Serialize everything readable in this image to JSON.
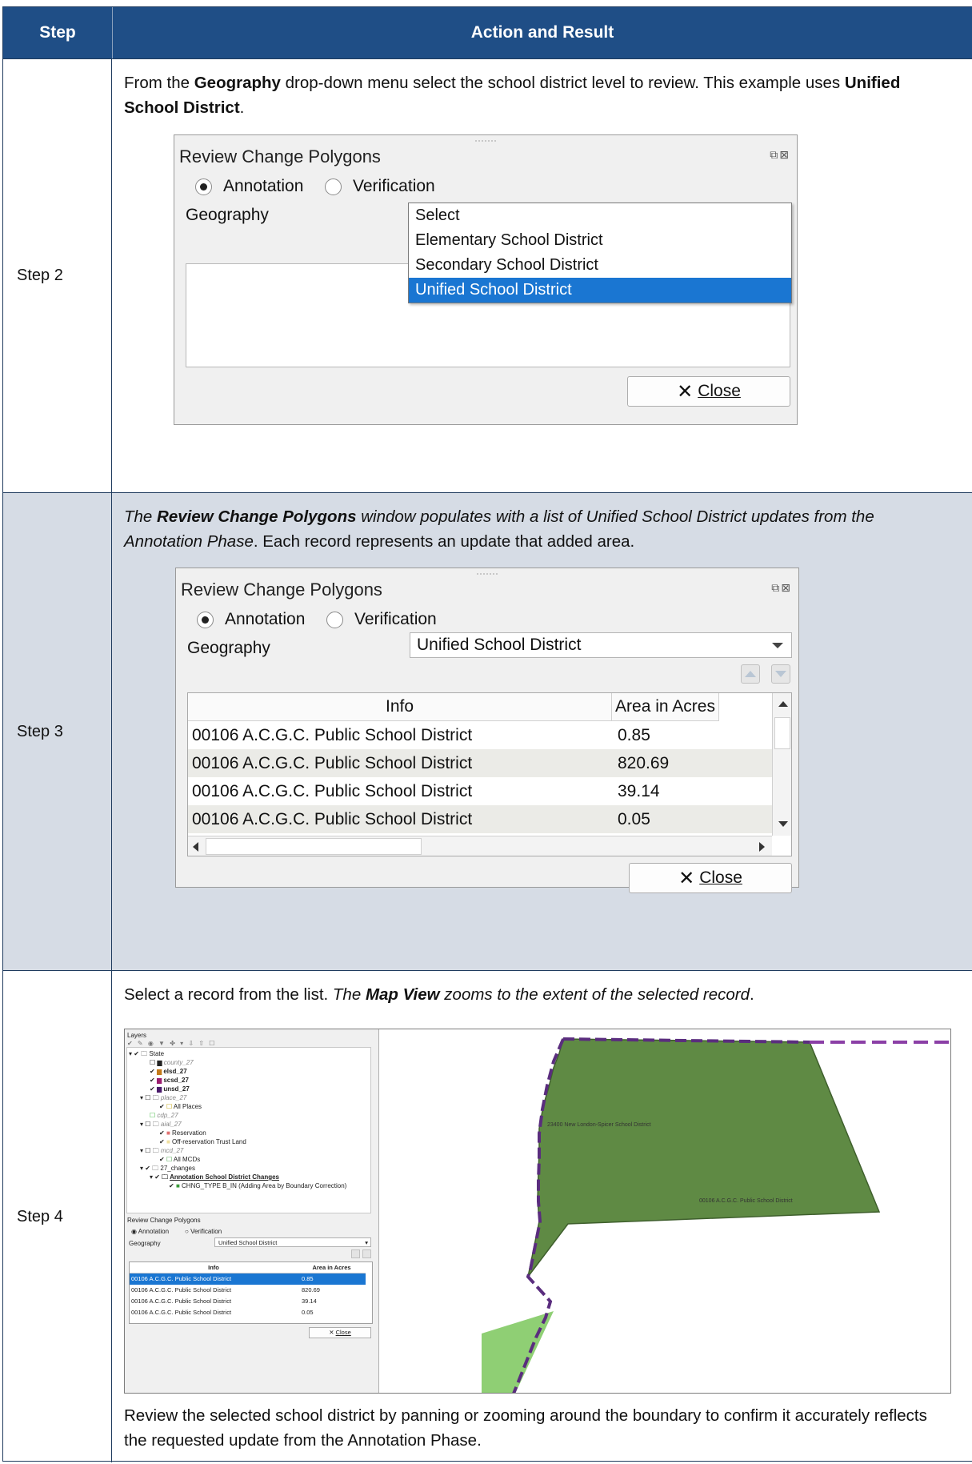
{
  "table": {
    "header": {
      "step": "Step",
      "action": "Action and Result"
    },
    "rows": [
      {
        "step": "Step 2",
        "text_parts": [
          "From the ",
          "Geography",
          " drop-down menu select the school district level to review. This example uses ",
          "Unified School District",
          "."
        ],
        "dialog": {
          "title": "Review Change Polygons",
          "radio_annotation": "Annotation",
          "radio_verification": "Verification",
          "geography_label": "Geography",
          "dropdown_options": [
            "Select",
            "Elementary School District",
            "Secondary School District",
            "Unified School District"
          ],
          "selected_option": "Unified School District",
          "close_label": "Close"
        }
      },
      {
        "step": "Step 3",
        "text_parts": [
          "The ",
          "Review Change Polygons",
          " window populates with a list of Unified School District updates from the Annotation Phase",
          ". Each record represents an update that added area."
        ],
        "dialog": {
          "title": "Review Change Polygons",
          "radio_annotation": "Annotation",
          "radio_verification": "Verification",
          "geography_label": "Geography",
          "geography_value": "Unified School District",
          "columns": [
            "Info",
            "Area in Acres"
          ],
          "records": [
            {
              "info": "00106 A.C.G.C. Public School District",
              "area": "0.85"
            },
            {
              "info": "00106 A.C.G.C. Public School District",
              "area": "820.69"
            },
            {
              "info": "00106 A.C.G.C. Public School District",
              "area": "39.14"
            },
            {
              "info": "00106 A.C.G.C. Public School District",
              "area": "0.05"
            }
          ],
          "close_label": "Close"
        }
      },
      {
        "step": "Step 4",
        "text_parts": [
          "Select a record from the list. ",
          "The ",
          "Map View",
          " zooms to the extent of the selected record",
          "."
        ],
        "text_after": "Review the selected school district by panning or zooming around the boundary to confirm it accurately reflects the requested update from the Annotation Phase.",
        "screenshot": {
          "layers_title": "Layers",
          "layers": [
            "State",
            "county_27",
            "elsd_27",
            "scsd_27",
            "unsd_27",
            "place_27",
            "All Places",
            "cdp_27",
            "aial_27",
            "Reservation",
            "Off-reservation Trust Land",
            "mcd_27",
            "All MCDs",
            "27_changes",
            "Annotation School District Changes",
            "CHNG_TYPE B_IN (Adding Area by Boundary Correction)"
          ],
          "panel_title": "Review Change Polygons",
          "radio_annotation": "Annotation",
          "radio_verification": "Verification",
          "geography_label": "Geography",
          "geography_value": "Unified School District",
          "columns": [
            "Info",
            "Area in Acres"
          ],
          "records": [
            {
              "info": "00106 A.C.G.C. Public School District",
              "area": "0.85"
            },
            {
              "info": "00106 A.C.G.C. Public School District",
              "area": "820.69"
            },
            {
              "info": "00106 A.C.G.C. Public School District",
              "area": "39.14"
            },
            {
              "info": "00106 A.C.G.C. Public School District",
              "area": "0.05"
            }
          ],
          "close_label": "Close",
          "map_labels": [
            "23400 New London-Spicer School District",
            "00106 A.C.G.C. Public School District"
          ]
        }
      }
    ]
  }
}
